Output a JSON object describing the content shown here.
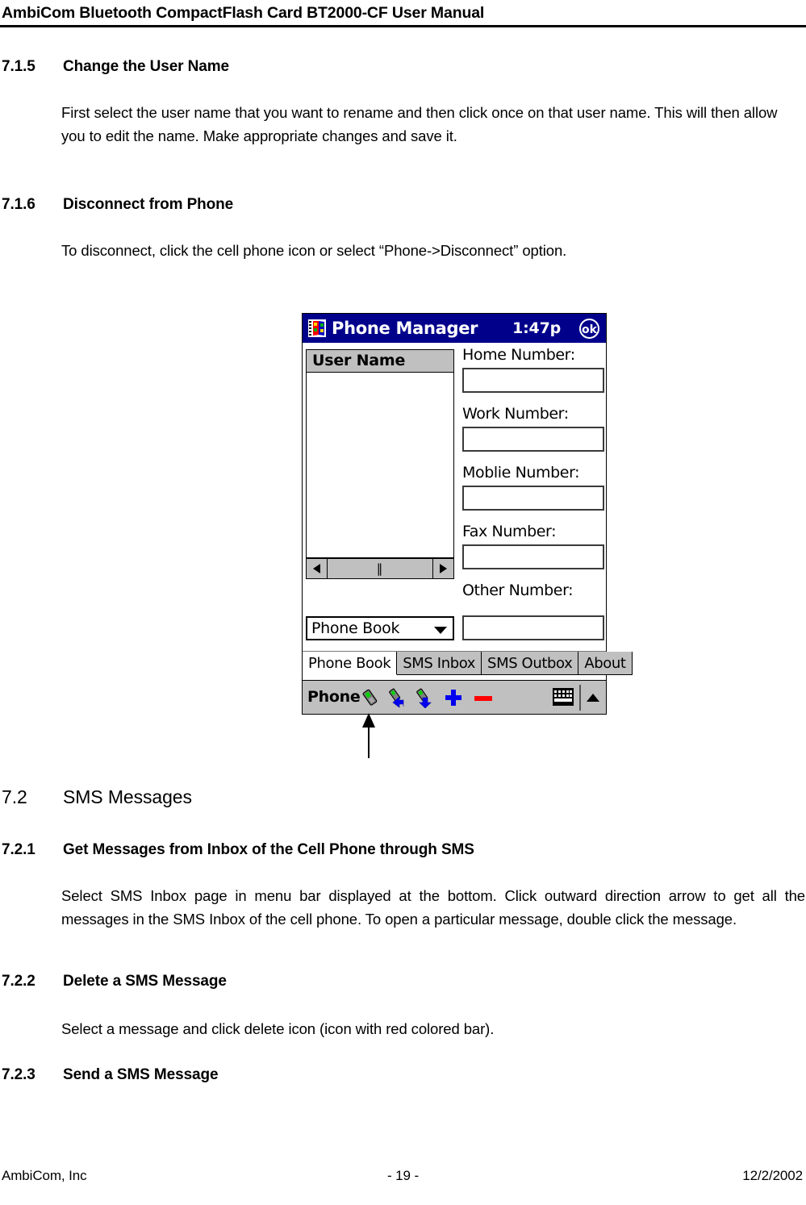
{
  "header": {
    "title": "AmbiCom Bluetooth CompactFlash Card BT2000-CF User Manual"
  },
  "sections": [
    {
      "number": "7.1.5",
      "title": "Change the User Name",
      "body": "First select the user name that you want to rename and then click once on that user name. This will then allow you to edit the name. Make appropriate changes and save it."
    },
    {
      "number": "7.1.6",
      "title": "Disconnect from Phone",
      "body": "To disconnect, click the cell phone icon or select “Phone->Disconnect” option."
    },
    {
      "number": "7.2",
      "title": "SMS Messages"
    },
    {
      "number": "7.2.1",
      "title": "Get Messages from Inbox of the Cell Phone through SMS",
      "body": "Select SMS Inbox page in menu bar displayed at the bottom. Click outward direction arrow to get all the messages in the SMS Inbox of the cell phone. To open a particular message, double click the message."
    },
    {
      "number": "7.2.2",
      "title": "Delete a SMS Message",
      "body": "Select a message and click delete icon (icon with red colored bar)."
    },
    {
      "number": "7.2.3",
      "title": "Send a SMS Message"
    }
  ],
  "figure": {
    "titlebar": {
      "icon": "windows-ce-app-icon",
      "title": "Phone Manager",
      "time": "1:47p",
      "ok_label": "ok"
    },
    "user_list": {
      "column_header": "User Name",
      "rows": [],
      "scrollbar": {
        "left_arrow": "scroll-left-icon",
        "thumb_grip": "‖",
        "right_arrow": "scroll-right-icon"
      }
    },
    "combo": {
      "selected": "Phone Book",
      "options": [
        "Phone Book"
      ]
    },
    "fields": [
      {
        "label": "Home Number:",
        "value": ""
      },
      {
        "label": "Work Number:",
        "value": ""
      },
      {
        "label": "Moblie Number:",
        "value": ""
      },
      {
        "label": "Fax Number:",
        "value": ""
      },
      {
        "label": "Other Number:",
        "value": ""
      }
    ],
    "tabs": [
      {
        "label": "Phone Book",
        "active": true
      },
      {
        "label": "SMS Inbox",
        "active": false
      },
      {
        "label": "SMS Outbox",
        "active": false
      },
      {
        "label": "About",
        "active": false
      }
    ],
    "commandbar": {
      "menu_label": "Phone",
      "icons": [
        "cell-phone-connect-icon",
        "sms-receive-inbox-icon",
        "sms-send-outbox-icon",
        "add-plus-icon",
        "delete-minus-icon",
        "keyboard-sip-icon",
        "sip-chevron-up-icon"
      ]
    },
    "colors": {
      "titlebar": "#00008B",
      "chrome": "#C0C0C0",
      "plus": "#0000FF",
      "minus": "#FF0000",
      "phone_screen": "#00D000"
    }
  },
  "footer": {
    "company": "AmbiCom, Inc",
    "page": "- 19 -",
    "date": "12/2/2002"
  }
}
